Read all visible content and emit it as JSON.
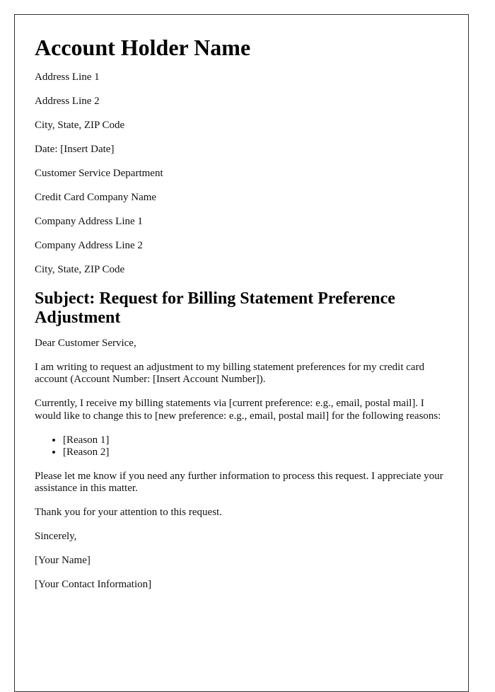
{
  "sender": {
    "name": "Account Holder Name",
    "address_line_1": "Address Line 1",
    "address_line_2": "Address Line 2",
    "city_state_zip": "City, State, ZIP Code"
  },
  "date": "Date: [Insert Date]",
  "recipient": {
    "department": "Customer Service Department",
    "company": "Credit Card Company Name",
    "address_line_1": "Company Address Line 1",
    "address_line_2": "Company Address Line 2",
    "city_state_zip": "City, State, ZIP Code"
  },
  "subject": "Subject: Request for Billing Statement Preference Adjustment",
  "salutation": "Dear Customer Service,",
  "body": {
    "paragraph_1": "I am writing to request an adjustment to my billing statement preferences for my credit card account (Account Number: [Insert Account Number]).",
    "paragraph_2": "Currently, I receive my billing statements via [current preference: e.g., email, postal mail]. I would like to change this to [new preference: e.g., email, postal mail] for the following reasons:",
    "reasons": [
      "[Reason 1]",
      "[Reason 2]"
    ],
    "paragraph_3": "Please let me know if you need any further information to process this request. I appreciate your assistance in this matter.",
    "paragraph_4": "Thank you for your attention to this request."
  },
  "closing": "Sincerely,",
  "signature": {
    "name": "[Your Name]",
    "contact": "[Your Contact Information]"
  }
}
